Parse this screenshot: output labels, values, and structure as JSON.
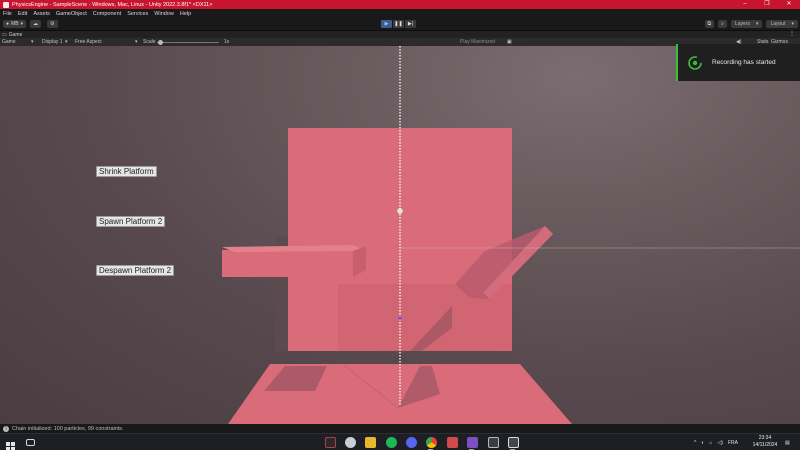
{
  "window": {
    "title": "PhysicsEngine - SampleScene - Windows, Mac, Linux - Unity 2022.3.8f1* <DX11>",
    "controls": [
      "–",
      "❐",
      "✕"
    ]
  },
  "menu": [
    "File",
    "Edit",
    "Assets",
    "GameObject",
    "Component",
    "Services",
    "Window",
    "Help"
  ],
  "toolbar": {
    "account_label": "MB",
    "layers_label": "Layers",
    "layout_label": "Layout"
  },
  "tab": {
    "label": "Game"
  },
  "gamebar": {
    "mode": "Game",
    "display": "Display 1",
    "aspect": "Free Aspect",
    "scale_label": "Scale",
    "scale_value": "1x",
    "play_mode": "Play Maximized",
    "stats": "Stats",
    "gizmos": "Gizmos"
  },
  "gui_buttons": {
    "shrink": "Shrink Platform",
    "spawn": "Spawn Platform 2",
    "despawn": "Despawn Platform 2"
  },
  "toast": {
    "text": "Recording has started"
  },
  "status": {
    "text": "Chain initialized: 100 particles, 99 constraints."
  },
  "taskbar": {
    "language": "FRA",
    "time": "23:34",
    "date": "14/11/2024"
  },
  "colors": {
    "titlebar": "#c8142e",
    "platform": "#d96c78",
    "toast_accent": "#3bc03b"
  }
}
